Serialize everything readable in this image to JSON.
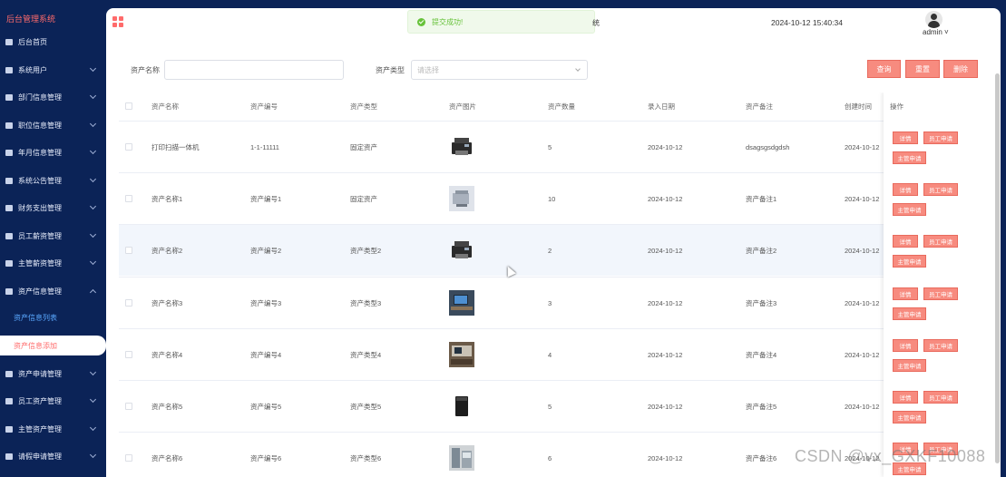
{
  "sidebar": {
    "title": "后台管理系统",
    "items": [
      {
        "label": "后台首页",
        "arrow": false
      },
      {
        "label": "系统用户",
        "arrow": true
      },
      {
        "label": "部门信息管理",
        "arrow": true
      },
      {
        "label": "职位信息管理",
        "arrow": true
      },
      {
        "label": "年月信息管理",
        "arrow": true
      },
      {
        "label": "系统公告管理",
        "arrow": true
      },
      {
        "label": "财务支出管理",
        "arrow": true
      },
      {
        "label": "员工薪资管理",
        "arrow": true
      },
      {
        "label": "主管薪资管理",
        "arrow": true
      },
      {
        "label": "资产信息管理",
        "arrow": true,
        "expanded": true
      },
      {
        "label": "资产申请管理",
        "arrow": true
      },
      {
        "label": "员工资产管理",
        "arrow": true
      },
      {
        "label": "主管资产管理",
        "arrow": true
      },
      {
        "label": "请假申请管理",
        "arrow": true
      }
    ],
    "subitems": [
      "资产信息列表",
      "资产信息添加"
    ]
  },
  "header": {
    "toast": "提交成功!",
    "toast_tail": "统",
    "datetime": "2024-10-12 15:40:34",
    "user": "admin"
  },
  "search": {
    "name_label": "资产名称",
    "name_value": "",
    "type_label": "资产类型",
    "type_placeholder": "请选择",
    "query": "查询",
    "reset": "重置",
    "delete": "删除"
  },
  "table": {
    "columns": [
      "资产名称",
      "资产编号",
      "资产类型",
      "资产图片",
      "资产数量",
      "录入日期",
      "资产备注",
      "创建时间",
      "操作"
    ],
    "rows": [
      {
        "name": "打印扫描一体机",
        "code": "1-1-11111",
        "type": "固定资产",
        "qty": "5",
        "date": "2024-10-12",
        "note": "dsagsgsdgdsh",
        "created": "2024-10-12",
        "img": "printer"
      },
      {
        "name": "资产名称1",
        "code": "资产编号1",
        "type": "固定资产",
        "qty": "10",
        "date": "2024-10-12",
        "note": "资产备注1",
        "created": "2024-10-12",
        "img": "device"
      },
      {
        "name": "资产名称2",
        "code": "资产编号2",
        "type": "资产类型2",
        "qty": "2",
        "date": "2024-10-12",
        "note": "资产备注2",
        "created": "2024-10-12",
        "img": "printer"
      },
      {
        "name": "资产名称3",
        "code": "资产编号3",
        "type": "资产类型3",
        "qty": "3",
        "date": "2024-10-12",
        "note": "资产备注3",
        "created": "2024-10-12",
        "img": "desk"
      },
      {
        "name": "资产名称4",
        "code": "资产编号4",
        "type": "资产类型4",
        "qty": "4",
        "date": "2024-10-12",
        "note": "资产备注4",
        "created": "2024-10-12",
        "img": "office"
      },
      {
        "name": "资产名称5",
        "code": "资产编号5",
        "type": "资产类型5",
        "qty": "5",
        "date": "2024-10-12",
        "note": "资产备注5",
        "created": "2024-10-12",
        "img": "shredder"
      },
      {
        "name": "资产名称6",
        "code": "资产编号6",
        "type": "资产类型6",
        "qty": "6",
        "date": "2024-10-12",
        "note": "资产备注6",
        "created": "2024-10-12",
        "img": "cabinet"
      }
    ],
    "actions": [
      "详情",
      "员工申请",
      "主管申请"
    ]
  },
  "watermark": "CSDN @vx_GXKF10088",
  "colors": {
    "sidebar": "#0b2357",
    "accent": "#f78b7f",
    "success": "#67c23a"
  }
}
